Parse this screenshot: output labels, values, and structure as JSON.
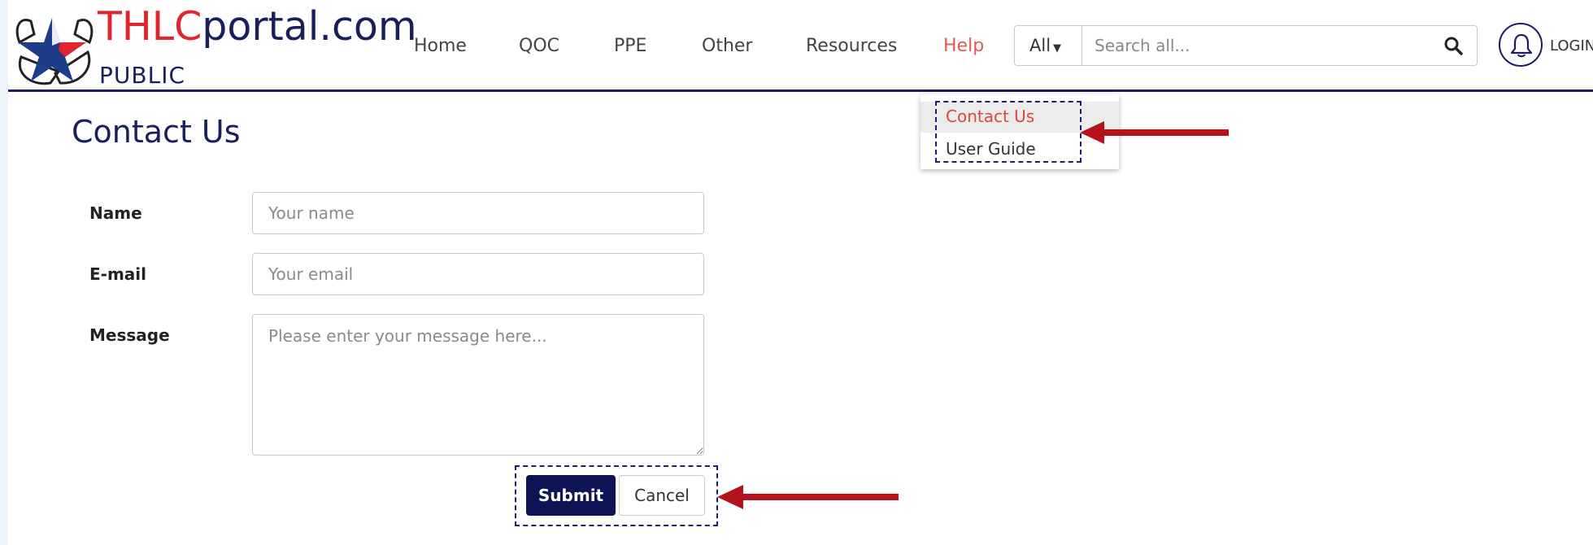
{
  "brand": {
    "name_red": "THLC",
    "name_navy": "portal.com",
    "sub": "PUBLIC"
  },
  "nav": {
    "items": [
      {
        "label": "Home"
      },
      {
        "label": "QOC"
      },
      {
        "label": "PPE"
      },
      {
        "label": "Other"
      },
      {
        "label": "Resources"
      },
      {
        "label": "Help",
        "active": true
      }
    ]
  },
  "search": {
    "scope": "All",
    "placeholder": "Search all...",
    "icon": "search-icon"
  },
  "user": {
    "bell_icon": "bell-icon",
    "login_label": "LOGIN"
  },
  "help_menu": {
    "items": [
      {
        "label": "Contact Us",
        "selected": true
      },
      {
        "label": "User Guide"
      }
    ]
  },
  "form": {
    "title": "Contact Us",
    "name_label": "Name",
    "name_placeholder": "Your name",
    "email_label": "E-mail",
    "email_placeholder": "Your email",
    "message_label": "Message",
    "message_placeholder": "Please enter your message here...",
    "submit_label": "Submit",
    "cancel_label": "Cancel"
  },
  "colors": {
    "navy": "#1a1f5c",
    "brand_red": "#e0252f",
    "active_link": "#e05a4f",
    "submit_bg": "#0e1355",
    "arrow_red": "#b5121b",
    "annotation_border": "#1b1f6e"
  }
}
